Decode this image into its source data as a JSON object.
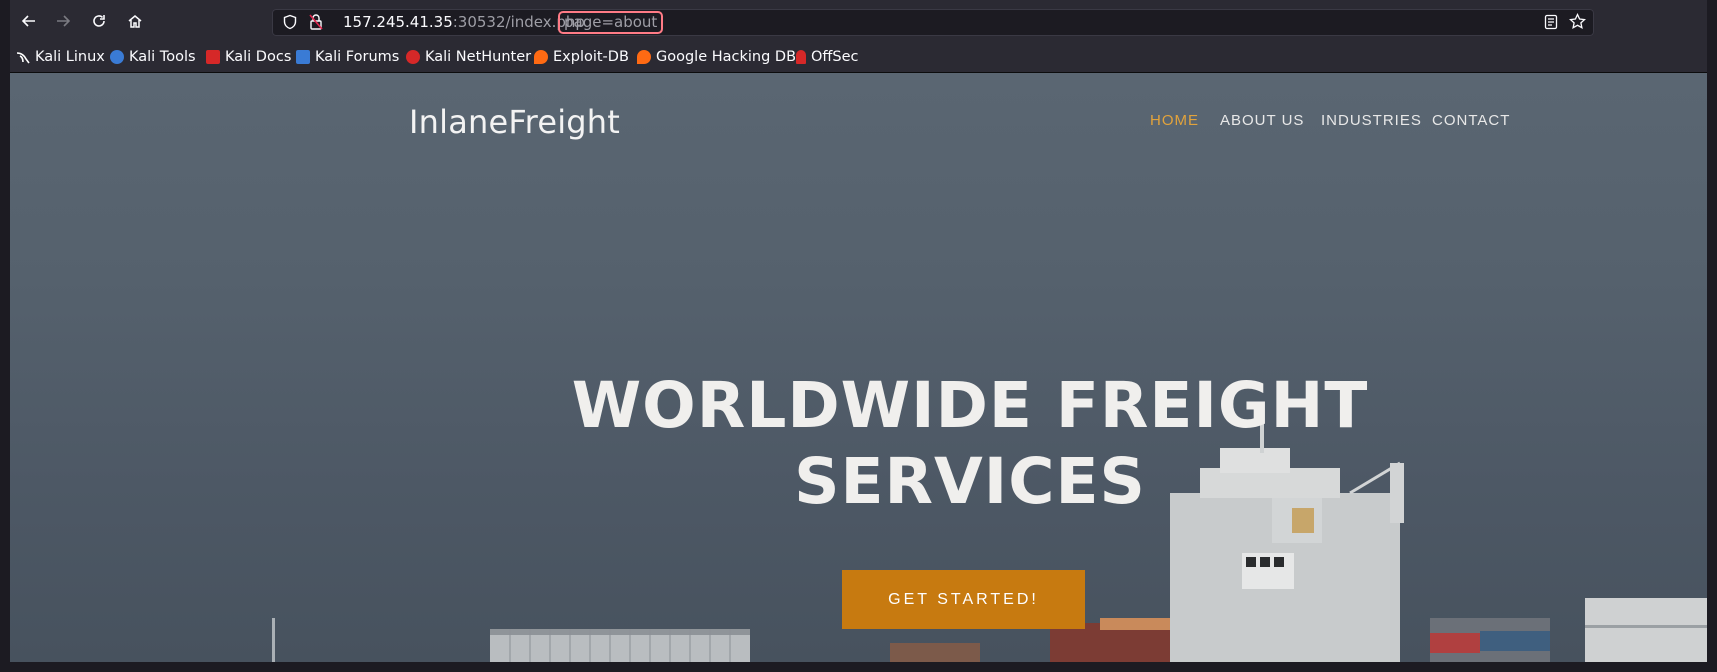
{
  "browser": {
    "url": {
      "host": "157.245.41.35",
      "port_path": ":30532/index.php",
      "query": "page=about"
    },
    "icons": {
      "back": "arrow-left-icon",
      "forward": "arrow-right-icon",
      "reload": "reload-icon",
      "home": "home-icon",
      "shield": "shield-icon",
      "lock": "lock-icon",
      "reader": "reader-mode-icon",
      "bookmark": "star-icon"
    }
  },
  "bookmarks": [
    {
      "label": "Kali Linux",
      "icon_color": "#ffffff"
    },
    {
      "label": "Kali Tools",
      "icon_color": "#3a7bd5"
    },
    {
      "label": "Kali Docs",
      "icon_color": "#d62828"
    },
    {
      "label": "Kali Forums",
      "icon_color": "#3a7bd5"
    },
    {
      "label": "Kali NetHunter",
      "icon_color": "#d62828"
    },
    {
      "label": "Exploit-DB",
      "icon_color": "#ff6a13"
    },
    {
      "label": "Google Hacking DB",
      "icon_color": "#ff6a13"
    },
    {
      "label": "OffSec",
      "icon_color": "#d62828"
    }
  ],
  "site": {
    "logo": "InlaneFreight",
    "nav": [
      "HOME",
      "ABOUT US",
      "INDUSTRIES",
      "CONTACT"
    ],
    "hero_line1": "WORLDWIDE FREIGHT",
    "hero_line2": "SERVICES",
    "cta": "GET STARTED!"
  },
  "colors": {
    "accent": "#c77a10",
    "nav_active": "#e2a33c",
    "highlight_box": "#ff7b86"
  }
}
